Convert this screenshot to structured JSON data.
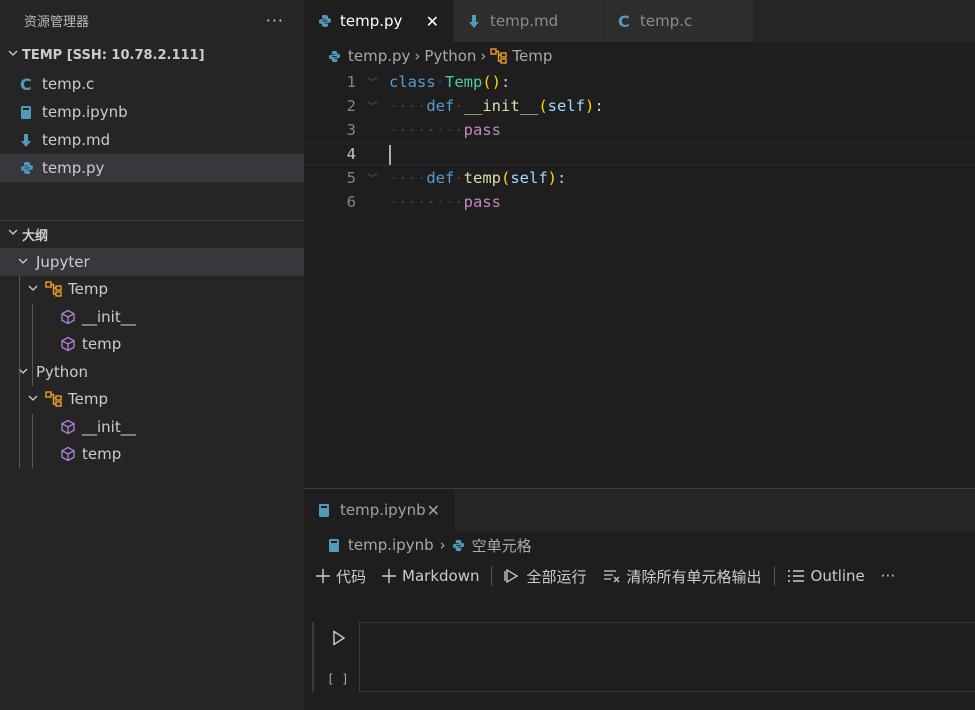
{
  "sidebar": {
    "title": "资源管理器",
    "more": "···",
    "workspace": "TEMP [SSH: 10.78.2.111]",
    "files": [
      {
        "name": "temp.c",
        "icon": "c-file-icon"
      },
      {
        "name": "temp.ipynb",
        "icon": "notebook-file-icon"
      },
      {
        "name": "temp.md",
        "icon": "markdown-file-icon"
      },
      {
        "name": "temp.py",
        "icon": "python-file-icon",
        "selected": true
      }
    ],
    "outline_title": "大纲",
    "outline": {
      "group1": "Jupyter",
      "group1_class": "Temp",
      "group1_m1": "__init__",
      "group1_m2": "temp",
      "group2": "Python",
      "group2_class": "Temp",
      "group2_m1": "__init__",
      "group2_m2": "temp"
    }
  },
  "editor": {
    "tabs": [
      {
        "label": "temp.py",
        "active": true,
        "close": "✕"
      },
      {
        "label": "temp.md"
      },
      {
        "label": "temp.c"
      }
    ],
    "breadcrumb": {
      "file": "temp.py",
      "lang": "Python",
      "symbol": "Temp"
    },
    "line_numbers": [
      "1",
      "2",
      "3",
      "4",
      "5",
      "6"
    ],
    "code": {
      "l1_kw": "class",
      "l1_name": "Temp",
      "l2_kw": "def",
      "l2_name": "__init__",
      "l2_self": "self",
      "l3": "pass",
      "l5_kw": "def",
      "l5_name": "temp",
      "l5_self": "self",
      "l6": "pass"
    },
    "current_line": 4
  },
  "panel": {
    "tab": {
      "label": "temp.ipynb",
      "close": "✕"
    },
    "breadcrumb": {
      "file": "temp.ipynb",
      "cell": "空单元格"
    },
    "toolbar": {
      "code": "代码",
      "markdown": "Markdown",
      "run_all": "全部运行",
      "clear": "清除所有单元格输出",
      "outline": "Outline",
      "more": "···"
    },
    "cell": {
      "count": "[ ]"
    }
  },
  "colors": {
    "python_blue": "#519aba",
    "c_blue": "#519aba",
    "outline_class": "#ee9d28",
    "outline_method": "#b180d7",
    "keyword": "#569cd6",
    "class_name": "#4ec9b0",
    "function": "#dcdcaa",
    "pass": "#c586c0"
  }
}
